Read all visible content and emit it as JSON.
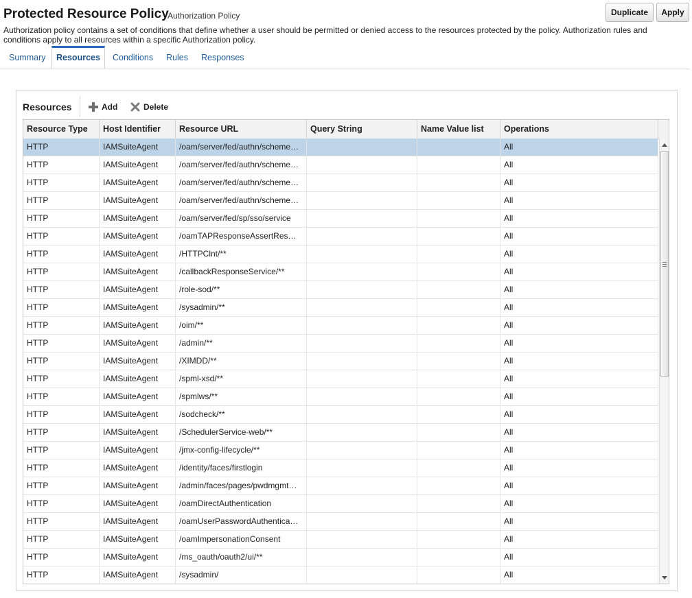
{
  "header": {
    "title": "Protected Resource Policy",
    "subtitle": "Authorization Policy",
    "duplicate_label": "Duplicate",
    "apply_label": "Apply",
    "description": "Authorization policy contains a set of conditions that define whether a user should be permitted or denied access to the resources protected by the policy. Authorization rules and conditions apply to all resources within a specific Authorization policy."
  },
  "tabs": [
    {
      "label": "Summary"
    },
    {
      "label": "Resources",
      "active": true
    },
    {
      "label": "Conditions"
    },
    {
      "label": "Rules"
    },
    {
      "label": "Responses"
    }
  ],
  "resources": {
    "heading": "Resources",
    "add_label": "Add",
    "delete_label": "Delete",
    "columns": [
      "Resource Type",
      "Host Identifier",
      "Resource URL",
      "Query String",
      "Name Value list",
      "Operations"
    ],
    "rows": [
      {
        "type": "HTTP",
        "host": "IAMSuiteAgent",
        "url": "/oam/server/fed/authn/scheme…",
        "query": "",
        "nvl": "",
        "ops": "All",
        "selected": true
      },
      {
        "type": "HTTP",
        "host": "IAMSuiteAgent",
        "url": "/oam/server/fed/authn/scheme…",
        "query": "",
        "nvl": "",
        "ops": "All"
      },
      {
        "type": "HTTP",
        "host": "IAMSuiteAgent",
        "url": "/oam/server/fed/authn/scheme…",
        "query": "",
        "nvl": "",
        "ops": "All"
      },
      {
        "type": "HTTP",
        "host": "IAMSuiteAgent",
        "url": "/oam/server/fed/authn/scheme…",
        "query": "",
        "nvl": "",
        "ops": "All"
      },
      {
        "type": "HTTP",
        "host": "IAMSuiteAgent",
        "url": "/oam/server/fed/sp/sso/service",
        "query": "",
        "nvl": "",
        "ops": "All"
      },
      {
        "type": "HTTP",
        "host": "IAMSuiteAgent",
        "url": "/oamTAPResponseAssertRes…",
        "query": "",
        "nvl": "",
        "ops": "All"
      },
      {
        "type": "HTTP",
        "host": "IAMSuiteAgent",
        "url": "/HTTPClnt/**",
        "query": "",
        "nvl": "",
        "ops": "All"
      },
      {
        "type": "HTTP",
        "host": "IAMSuiteAgent",
        "url": "/callbackResponseService/**",
        "query": "",
        "nvl": "",
        "ops": "All"
      },
      {
        "type": "HTTP",
        "host": "IAMSuiteAgent",
        "url": "/role-sod/**",
        "query": "",
        "nvl": "",
        "ops": "All"
      },
      {
        "type": "HTTP",
        "host": "IAMSuiteAgent",
        "url": "/sysadmin/**",
        "query": "",
        "nvl": "",
        "ops": "All"
      },
      {
        "type": "HTTP",
        "host": "IAMSuiteAgent",
        "url": "/oim/**",
        "query": "",
        "nvl": "",
        "ops": "All"
      },
      {
        "type": "HTTP",
        "host": "IAMSuiteAgent",
        "url": "/admin/**",
        "query": "",
        "nvl": "",
        "ops": "All"
      },
      {
        "type": "HTTP",
        "host": "IAMSuiteAgent",
        "url": "/XIMDD/**",
        "query": "",
        "nvl": "",
        "ops": "All"
      },
      {
        "type": "HTTP",
        "host": "IAMSuiteAgent",
        "url": "/spml-xsd/**",
        "query": "",
        "nvl": "",
        "ops": "All"
      },
      {
        "type": "HTTP",
        "host": "IAMSuiteAgent",
        "url": "/spmlws/**",
        "query": "",
        "nvl": "",
        "ops": "All"
      },
      {
        "type": "HTTP",
        "host": "IAMSuiteAgent",
        "url": "/sodcheck/**",
        "query": "",
        "nvl": "",
        "ops": "All"
      },
      {
        "type": "HTTP",
        "host": "IAMSuiteAgent",
        "url": "/SchedulerService-web/**",
        "query": "",
        "nvl": "",
        "ops": "All"
      },
      {
        "type": "HTTP",
        "host": "IAMSuiteAgent",
        "url": "/jmx-config-lifecycle/**",
        "query": "",
        "nvl": "",
        "ops": "All"
      },
      {
        "type": "HTTP",
        "host": "IAMSuiteAgent",
        "url": "/identity/faces/firstlogin",
        "query": "",
        "nvl": "",
        "ops": "All"
      },
      {
        "type": "HTTP",
        "host": "IAMSuiteAgent",
        "url": "/admin/faces/pages/pwdmgmt…",
        "query": "",
        "nvl": "",
        "ops": "All"
      },
      {
        "type": "HTTP",
        "host": "IAMSuiteAgent",
        "url": "/oamDirectAuthentication",
        "query": "",
        "nvl": "",
        "ops": "All"
      },
      {
        "type": "HTTP",
        "host": "IAMSuiteAgent",
        "url": "/oamUserPasswordAuthentica…",
        "query": "",
        "nvl": "",
        "ops": "All"
      },
      {
        "type": "HTTP",
        "host": "IAMSuiteAgent",
        "url": "/oamImpersonationConsent",
        "query": "",
        "nvl": "",
        "ops": "All"
      },
      {
        "type": "HTTP",
        "host": "IAMSuiteAgent",
        "url": "/ms_oauth/oauth2/ui/**",
        "query": "",
        "nvl": "",
        "ops": "All"
      },
      {
        "type": "HTTP",
        "host": "IAMSuiteAgent",
        "url": "/sysadmin/",
        "query": "",
        "nvl": "",
        "ops": "All"
      }
    ]
  },
  "colors": {
    "link": "#1f5c99",
    "active_tab_border": "#2a6ebb",
    "selected_row": "#bdd3e7",
    "header_bg": "#f2f2f2"
  }
}
